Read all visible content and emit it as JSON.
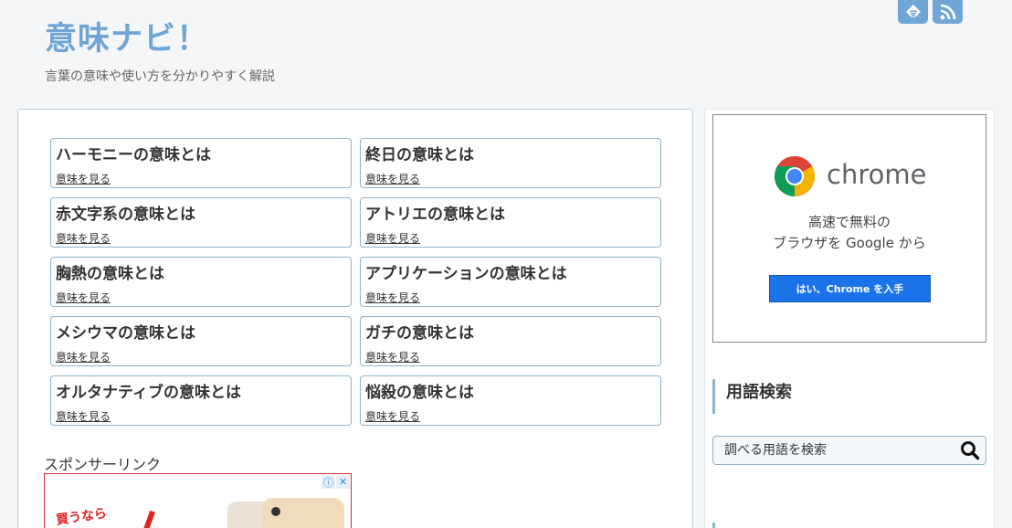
{
  "header": {
    "site_title": "意味ナビ！",
    "site_description": "言葉の意味や使い方を分かりやすく解説"
  },
  "icons": {
    "feedly": "feedly-icon",
    "rss": "rss-icon",
    "search": "search-icon",
    "chrome": "chrome-logo-icon",
    "ad_info": "info-icon",
    "ad_close": "close-icon"
  },
  "colors": {
    "accent": "#6fa6d6",
    "card_border": "#90b3cc",
    "chrome_button": "#1a73e8"
  },
  "articles": [
    {
      "title": "ハーモニーの意味とは",
      "link": "意味を見る"
    },
    {
      "title": "終日の意味とは",
      "link": "意味を見る"
    },
    {
      "title": "赤文字系の意味とは",
      "link": "意味を見る"
    },
    {
      "title": "アトリエの意味とは",
      "link": "意味を見る"
    },
    {
      "title": "胸熱の意味とは",
      "link": "意味を見る"
    },
    {
      "title": "アプリケーションの意味とは",
      "link": "意味を見る"
    },
    {
      "title": "メシウマの意味とは",
      "link": "意味を見る"
    },
    {
      "title": "ガチの意味とは",
      "link": "意味を見る"
    },
    {
      "title": "オルタナティブの意味とは",
      "link": "意味を見る"
    },
    {
      "title": "悩殺の意味とは",
      "link": "意味を見る"
    }
  ],
  "sponsor_label": "スポンサーリンク",
  "bottom_ad": {
    "text": "買うなら",
    "info": "ⓘ",
    "close": "✕"
  },
  "sidebar": {
    "chrome_ad": {
      "brand": "chrome",
      "line1": "高速で無料の",
      "line2": "ブラウザを Google から",
      "button": "はい、Chrome を入手"
    },
    "search_widget": {
      "title": "用語検索",
      "placeholder": "調べる用語を検索"
    }
  }
}
